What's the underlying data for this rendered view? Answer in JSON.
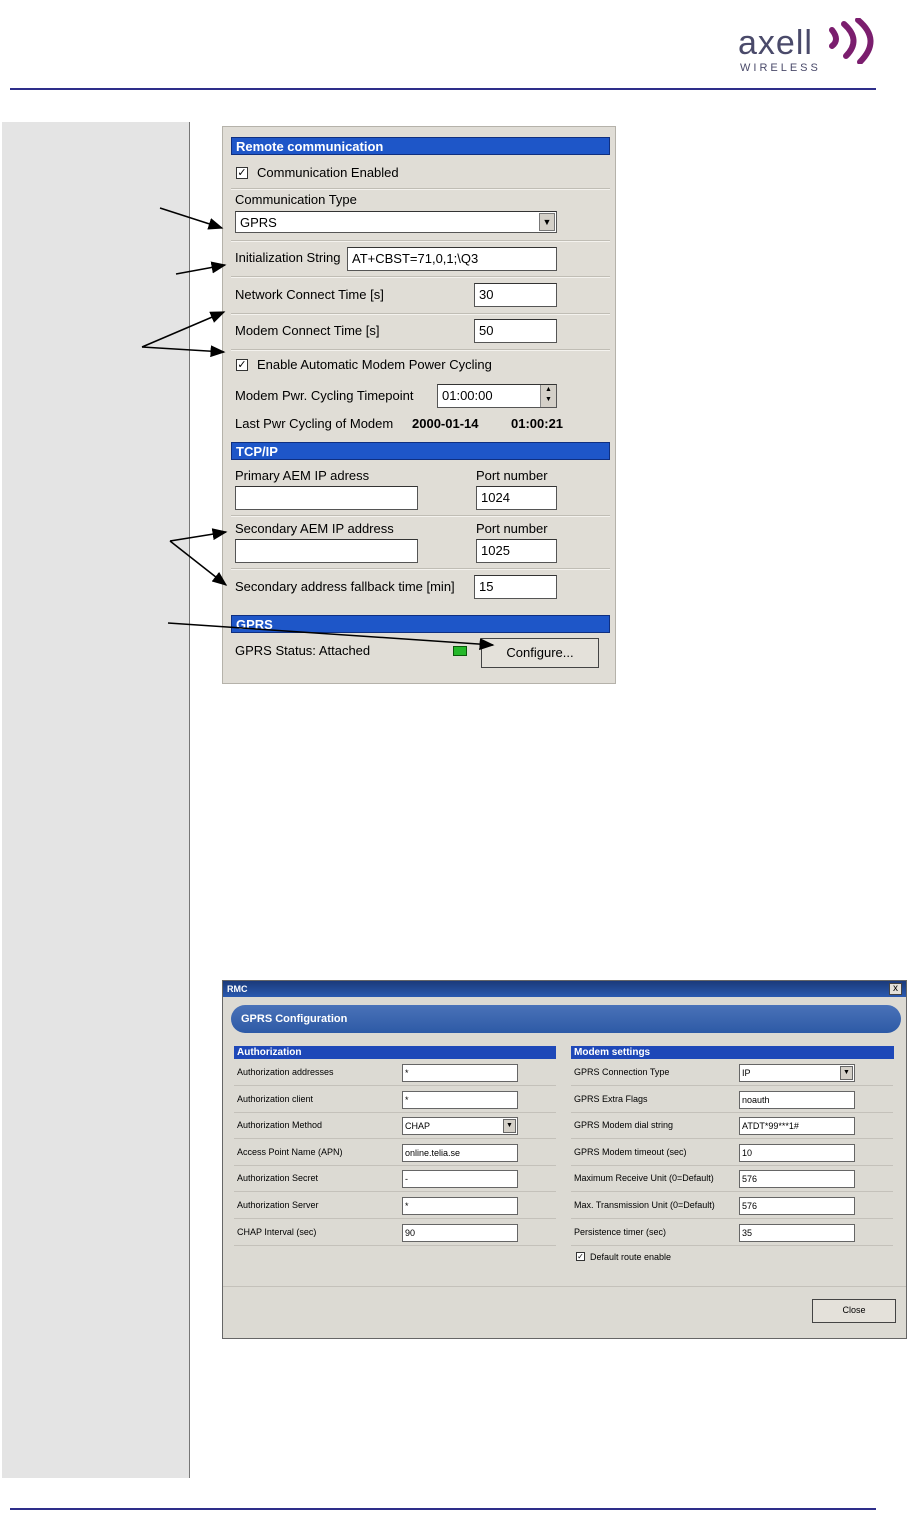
{
  "header": {
    "logo_word": "axell",
    "logo_sub": "WIRELESS"
  },
  "remote_panel": {
    "title": "Remote communication",
    "communication_enabled": {
      "label": "Communication Enabled",
      "checked": true
    },
    "communication_type": {
      "label": "Communication Type",
      "value": "GPRS"
    },
    "init_string": {
      "label": "Initialization String",
      "value": "AT+CBST=71,0,1;\\Q3"
    },
    "network_connect_time": {
      "label": "Network Connect Time [s]",
      "value": "30"
    },
    "modem_connect_time": {
      "label": "Modem Connect Time [s]",
      "value": "50"
    },
    "auto_power_cycling": {
      "label": "Enable Automatic Modem Power Cycling",
      "checked": true
    },
    "cycling_timepoint": {
      "label": "Modem Pwr. Cycling Timepoint",
      "value": "01:00:00"
    },
    "last_cycling": {
      "label": "Last Pwr Cycling of Modem",
      "date": "2000-01-14",
      "time": "01:00:21"
    },
    "tcpip_title": "TCP/IP",
    "primary_ip": {
      "label": "Primary AEM IP adress",
      "value": ""
    },
    "primary_port": {
      "label": "Port number",
      "value": "1024"
    },
    "secondary_ip": {
      "label": "Secondary AEM IP address",
      "value": ""
    },
    "secondary_port": {
      "label": "Port number",
      "value": "1025"
    },
    "fallback_time": {
      "label": "Secondary address fallback time [min]",
      "value": "15"
    },
    "gprs_title": "GPRS",
    "gprs_status": "GPRS Status: Attached",
    "configure_button": "Configure..."
  },
  "gprs_dialog": {
    "window_title": "RMC",
    "close_x": "x",
    "banner": "GPRS Configuration",
    "authorization": {
      "title": "Authorization",
      "rows": [
        {
          "label": "Authorization addresses",
          "value": "*"
        },
        {
          "label": "Authorization client",
          "value": "*"
        },
        {
          "label": "Authorization Method",
          "value": "CHAP"
        },
        {
          "label": "Access Point Name (APN)",
          "value": "online.telia.se"
        },
        {
          "label": "Authorization Secret",
          "value": "-"
        },
        {
          "label": "Authorization Server",
          "value": "*"
        },
        {
          "label": "CHAP Interval (sec)",
          "value": "90"
        }
      ]
    },
    "modem": {
      "title": "Modem settings",
      "rows": [
        {
          "label": "GPRS Connection Type",
          "value": "IP"
        },
        {
          "label": "GPRS Extra Flags",
          "value": "noauth"
        },
        {
          "label": "GPRS Modem dial string",
          "value": "ATDT*99***1#"
        },
        {
          "label": "GPRS Modem timeout (sec)",
          "value": "10"
        },
        {
          "label": "Maximum Receive Unit (0=Default)",
          "value": "576"
        },
        {
          "label": "Max. Transmission Unit (0=Default)",
          "value": "576"
        },
        {
          "label": "Persistence timer (sec)",
          "value": "35"
        }
      ],
      "default_route": {
        "label": "Default route enable",
        "checked": true
      }
    },
    "close_button": "Close"
  }
}
